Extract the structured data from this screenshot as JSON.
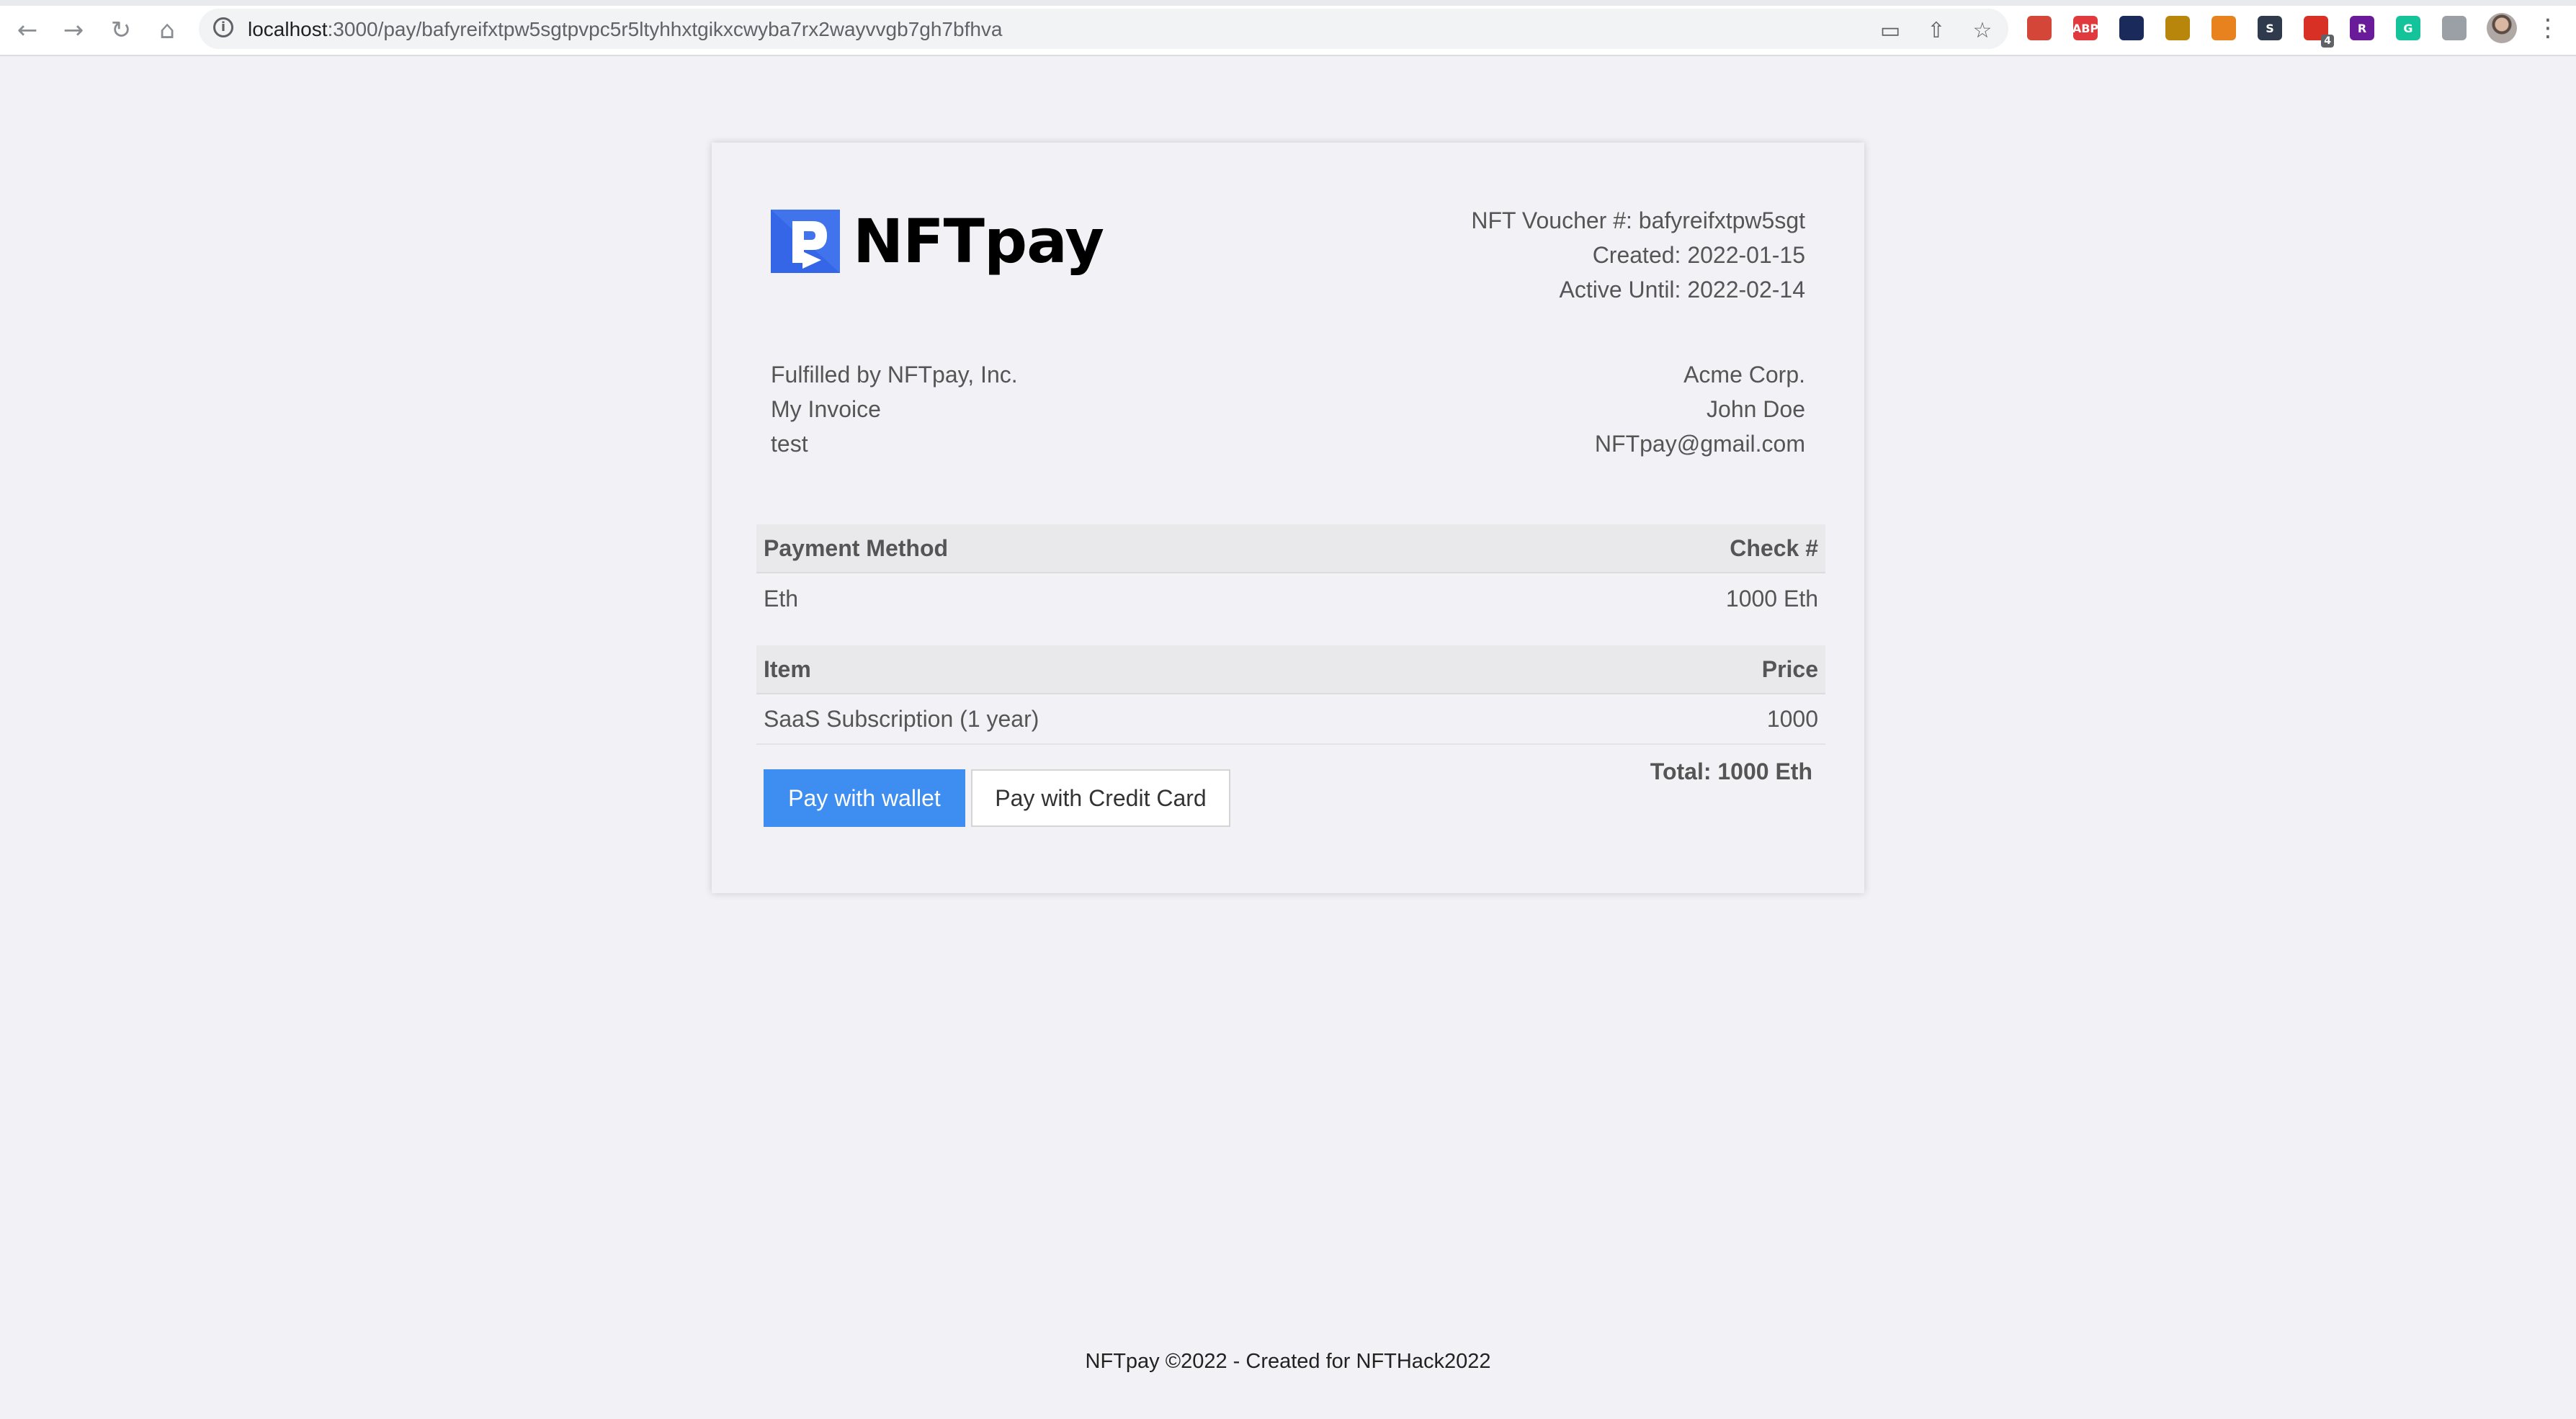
{
  "browser": {
    "url_host": "localhost",
    "url_path": ":3000/pay/bafyreifxtpw5sgtpvpc5r5ltyhhxtgikxcwyba7rx2wayvvgb7gh7bfhva",
    "nav_icons": [
      "back-arrow-icon",
      "forward-arrow-icon",
      "reload-icon",
      "home-icon"
    ],
    "info_icon": "info-icon",
    "omnibox_actions": [
      "card-icon",
      "share-icon",
      "bookmark-star-icon"
    ],
    "extensions": [
      {
        "name": "extension-1-icon",
        "label": "",
        "color": "#d44638"
      },
      {
        "name": "adblock-plus-icon",
        "label": "ABP",
        "color": "#e03a3e"
      },
      {
        "name": "extension-3-icon",
        "label": "",
        "color": "#1a2a5a"
      },
      {
        "name": "extension-4-icon",
        "label": "",
        "color": "#b8860b"
      },
      {
        "name": "metamask-fox-icon",
        "label": "",
        "color": "#e8821e"
      },
      {
        "name": "extension-s-icon",
        "label": "S",
        "color": "#2f3b4c"
      },
      {
        "name": "extension-7-icon",
        "label": "",
        "color": "#d93025",
        "badge": "4"
      },
      {
        "name": "extension-r-icon",
        "label": "R",
        "color": "#6a1b9a"
      },
      {
        "name": "grammarly-icon",
        "label": "G",
        "color": "#15c39a"
      },
      {
        "name": "extensions-puzzle-icon",
        "label": "",
        "color": "#9aa0a6"
      }
    ]
  },
  "brand": {
    "name": "NFTpay",
    "accent": "#3d8ef0"
  },
  "voucher": {
    "number_line": "NFT Voucher #: bafyreifxtpw5sgt",
    "created_line": "Created: 2022-01-15",
    "active_until_line": "Active Until: 2022-02-14"
  },
  "from": {
    "fulfilled_by": "Fulfilled by NFTpay, Inc.",
    "invoice_name": "My Invoice",
    "description": "test"
  },
  "to": {
    "company": "Acme Corp.",
    "contact": "John Doe",
    "email": "NFTpay@gmail.com"
  },
  "payment_table": {
    "headers": [
      "Payment Method",
      "Check #"
    ],
    "rows": [
      [
        "Eth",
        "1000 Eth"
      ]
    ]
  },
  "items_table": {
    "headers": [
      "Item",
      "Price"
    ],
    "rows": [
      [
        "SaaS Subscription (1 year)",
        "1000"
      ]
    ]
  },
  "total": "Total: 1000 Eth",
  "actions": {
    "pay_wallet": "Pay with wallet",
    "pay_card": "Pay with Credit Card"
  },
  "footer": "NFTpay ©2022 - Created for NFTHack2022"
}
